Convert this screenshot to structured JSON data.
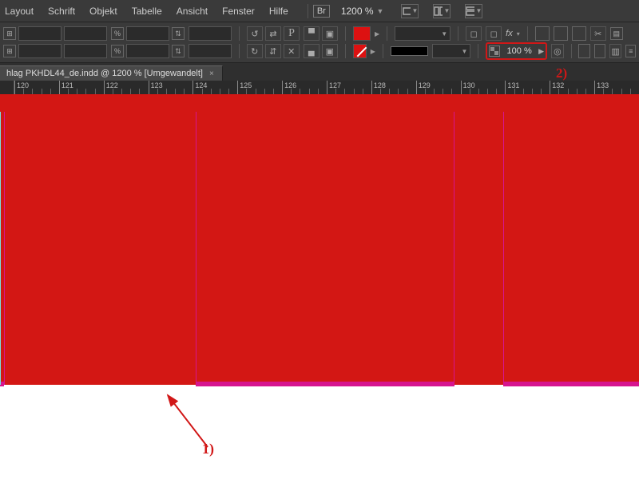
{
  "menu": {
    "items": [
      "Layout",
      "Schrift",
      "Objekt",
      "Tabelle",
      "Ansicht",
      "Fenster",
      "Hilfe"
    ],
    "bridge_badge": "Br",
    "zoom_main": "1200 %"
  },
  "controlbar": {
    "opacity": "100 %",
    "fx_label": "fx",
    "p_glyph": "P"
  },
  "document": {
    "tab_title": "hlag PKHDL44_de.indd @ 1200 % [Umgewandelt]"
  },
  "ruler": {
    "start": 120,
    "end": 133,
    "ticks": [
      120,
      121,
      122,
      123,
      124,
      125,
      126,
      127,
      128,
      129,
      130,
      131,
      132,
      133
    ]
  },
  "annotations": {
    "one": "1)",
    "two": "2)"
  },
  "colors": {
    "red_fill": "#d31714",
    "magenta": "#d6158f",
    "highlight": "#d11717"
  }
}
